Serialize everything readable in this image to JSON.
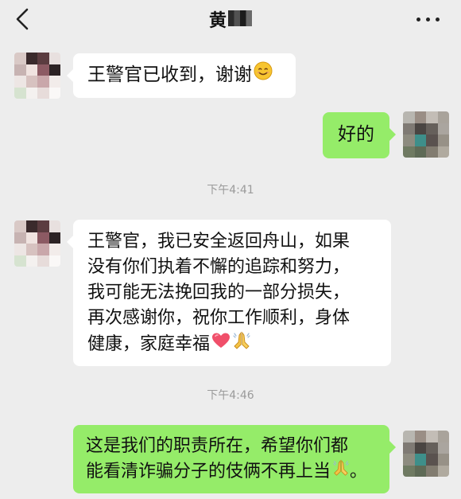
{
  "header": {
    "title": "黄"
  },
  "messages": [
    {
      "side": "left",
      "text": "王警官已收到，谢谢",
      "emoji": "smiling-face-emoji"
    },
    {
      "side": "right",
      "text": "好的"
    },
    {
      "side": "left",
      "lines": [
        "王警官，我已安全返回舟山，如果",
        "没有你们执着不懈的追踪和努力，",
        "我可能无法挽回我的一部分损失，",
        "再次感谢你，祝你工作顺利，身体",
        "健康，家庭幸福"
      ],
      "emojis": [
        "red-heart-emoji",
        "folded-hands-emoji"
      ]
    },
    {
      "side": "right",
      "lines": [
        "这是我们的职责所在，希望你们都",
        "能看清诈骗分子的伎俩不再上当",
        "。"
      ],
      "emoji": "folded-hands-emoji"
    }
  ],
  "timestamps": [
    "下午4:41",
    "下午4:46"
  ],
  "colors": {
    "background": "#ededed",
    "bubble_left": "#ffffff",
    "bubble_right": "#95ec69",
    "timestamp_text": "#9b9b9b"
  },
  "icons": [
    "back-arrow-icon",
    "more-options-icon"
  ]
}
